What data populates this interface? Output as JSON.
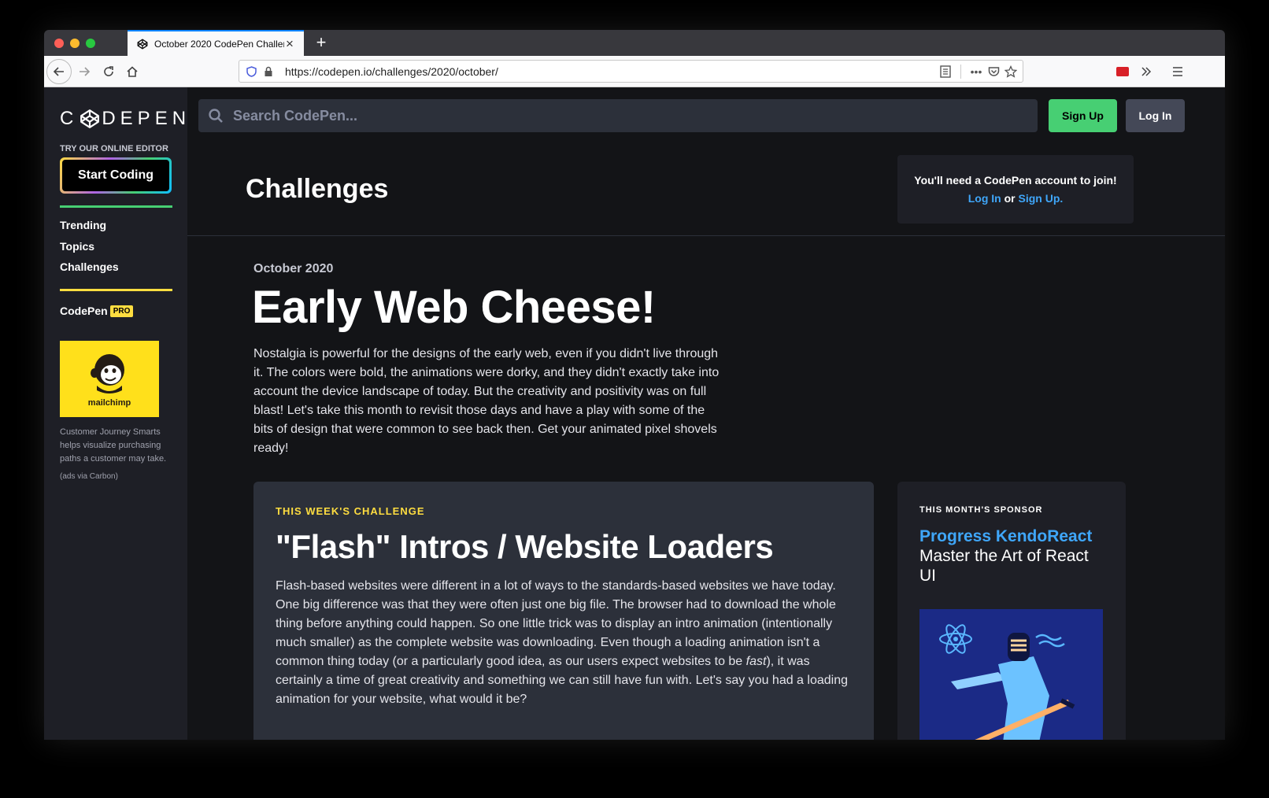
{
  "browser": {
    "tab_title": "October 2020 CodePen Challen",
    "new_tab": "+",
    "url": "https://codepen.io/challenges/2020/october/"
  },
  "sidebar": {
    "logo": "CODEPEN",
    "try_label": "TRY OUR ONLINE EDITOR",
    "start_coding": "Start Coding",
    "links": [
      "Trending",
      "Topics",
      "Challenges"
    ],
    "codepen": "CodePen",
    "pro_badge": "PRO",
    "ad": {
      "brand": "mailchimp",
      "text": "Customer Journey Smarts helps visualize purchasing paths a customer may take.",
      "via": "(ads via Carbon)"
    }
  },
  "topbar": {
    "search_placeholder": "Search CodePen...",
    "sign_up": "Sign Up",
    "log_in": "Log In"
  },
  "header": {
    "title": "Challenges",
    "join_text": "You'll need a CodePen account to join!",
    "join_login": "Log In",
    "join_or": "or",
    "join_signup": "Sign Up",
    "join_period": "."
  },
  "main": {
    "month": "October 2020",
    "title": "Early Web Cheese!",
    "intro": "Nostalgia is powerful for the designs of the early web, even if you didn't live through it. The colors were bold, the animations were dorky, and they didn't exactly take into account the device landscape of today. But the creativity and positivity was on full blast! Let's take this month to revisit those days and have a play with some of the bits of design that were common to see back then. Get your animated pixel shovels ready!"
  },
  "challenge": {
    "label": "THIS WEEK'S CHALLENGE",
    "title": "\"Flash\" Intros / Website Loaders",
    "body_a": "Flash-based websites were different in a lot of ways to the standards-based websites we have today. One big difference was that they were often just one big file. The browser had to download the whole thing before anything could happen. So one little trick was to display an intro animation (intentionally much smaller) as the complete website was downloading. Even though a loading animation isn't a common thing today (or a particularly good idea, as our users expect websites to be ",
    "body_em": "fast",
    "body_b": "), it was certainly a time of great creativity and something we can still have fun with. Let's say you had a loading animation for your website, what would it be?"
  },
  "sponsor": {
    "label": "THIS MONTH'S SPONSOR",
    "name": "Progress KendoReact",
    "tagline": "Master the Art of React UI"
  },
  "colors": {
    "accent_green": "#47cf73",
    "accent_yellow": "#ffdd40",
    "link_blue": "#3fa6f9",
    "bg": "#131417",
    "sidebar_bg": "#1e1f26"
  }
}
